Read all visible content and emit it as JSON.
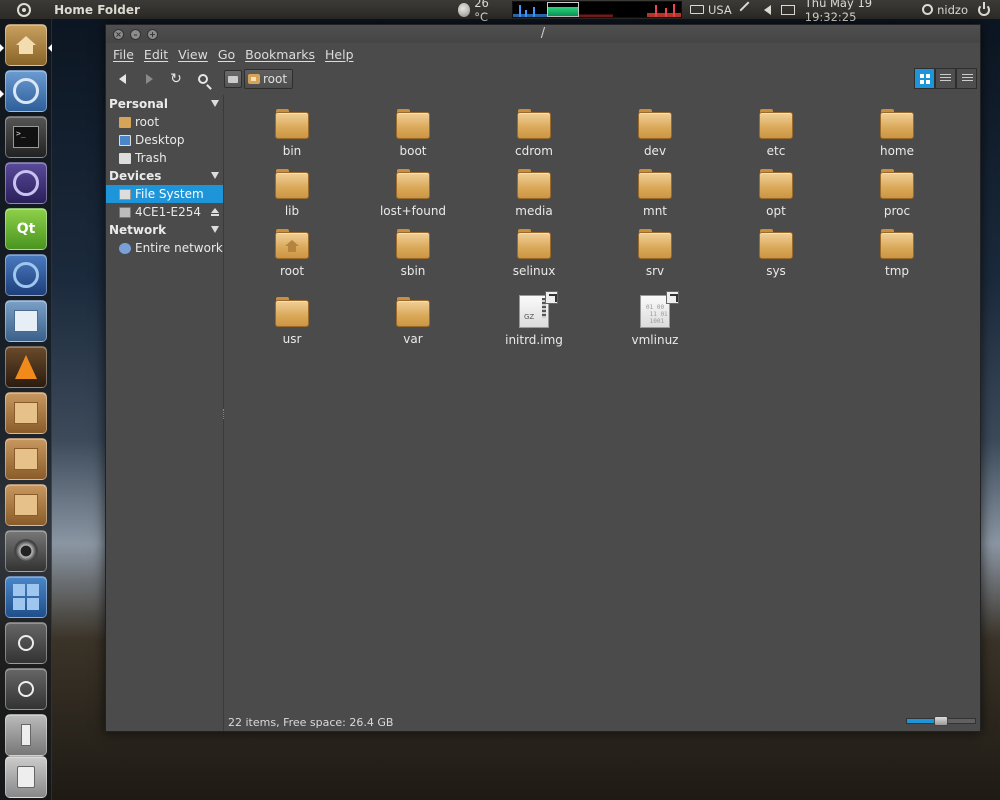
{
  "top_panel": {
    "app_title": "Home Folder",
    "temperature": "26 °C",
    "keyboard_layout": "USA",
    "datetime": "Thu May 19 19:32:25",
    "username": "nidzo"
  },
  "launcher": {
    "items": [
      {
        "name": "Home Folder",
        "icon": "home-folder-icon"
      },
      {
        "name": "Chromium",
        "icon": "chromium-icon"
      },
      {
        "name": "Terminal",
        "icon": "terminal-icon"
      },
      {
        "name": "Eclipse",
        "icon": "eclipse-icon"
      },
      {
        "name": "Qt Creator",
        "icon": "qt-icon",
        "glyph": "Qt"
      },
      {
        "name": "Web Browser",
        "icon": "globe-icon"
      },
      {
        "name": "Mail",
        "icon": "mail-icon"
      },
      {
        "name": "VLC",
        "icon": "vlc-icon"
      },
      {
        "name": "Package",
        "icon": "package-icon"
      },
      {
        "name": "Package Installer",
        "icon": "package-install-icon"
      },
      {
        "name": "Package Disc",
        "icon": "package-disc-icon"
      },
      {
        "name": "Camera",
        "icon": "camera-icon"
      },
      {
        "name": "Workspaces",
        "icon": "workspace-switcher-icon"
      },
      {
        "name": "Zoom In",
        "icon": "zoom-in-icon"
      },
      {
        "name": "Zoom Fit",
        "icon": "zoom-fit-icon"
      },
      {
        "name": "USB Drive",
        "icon": "usb-drive-icon"
      },
      {
        "name": "Trash",
        "icon": "trash-icon"
      }
    ]
  },
  "window": {
    "title": "/",
    "menu": [
      "File",
      "Edit",
      "View",
      "Go",
      "Bookmarks",
      "Help"
    ],
    "breadcrumb": {
      "current": "root"
    },
    "view_mode": "icons",
    "sidebar": {
      "personal": {
        "header": "Personal",
        "items": [
          "root",
          "Desktop",
          "Trash"
        ]
      },
      "devices": {
        "header": "Devices",
        "items": [
          "File System",
          "4CE1-E254"
        ],
        "selected": "File System"
      },
      "network": {
        "header": "Network",
        "items": [
          "Entire network"
        ]
      }
    },
    "files": [
      {
        "name": "bin",
        "type": "folder"
      },
      {
        "name": "boot",
        "type": "folder"
      },
      {
        "name": "cdrom",
        "type": "folder"
      },
      {
        "name": "dev",
        "type": "folder"
      },
      {
        "name": "etc",
        "type": "folder"
      },
      {
        "name": "home",
        "type": "folder"
      },
      {
        "name": "lib",
        "type": "folder"
      },
      {
        "name": "lost+found",
        "type": "folder"
      },
      {
        "name": "media",
        "type": "folder"
      },
      {
        "name": "mnt",
        "type": "folder"
      },
      {
        "name": "opt",
        "type": "folder"
      },
      {
        "name": "proc",
        "type": "folder"
      },
      {
        "name": "root",
        "type": "home-folder"
      },
      {
        "name": "sbin",
        "type": "folder"
      },
      {
        "name": "selinux",
        "type": "folder"
      },
      {
        "name": "srv",
        "type": "folder"
      },
      {
        "name": "sys",
        "type": "folder"
      },
      {
        "name": "tmp",
        "type": "folder"
      },
      {
        "name": "usr",
        "type": "folder"
      },
      {
        "name": "var",
        "type": "folder"
      },
      {
        "name": "initrd.img",
        "type": "gz-link",
        "badge": "GZ"
      },
      {
        "name": "vmlinuz",
        "type": "binary-link",
        "glyph": "01 00\n 11 01\n 1001"
      }
    ],
    "status": "22 items, Free space: 26.4 GB",
    "zoom_level": 0.5,
    "accent_color": "#1e95d8"
  }
}
